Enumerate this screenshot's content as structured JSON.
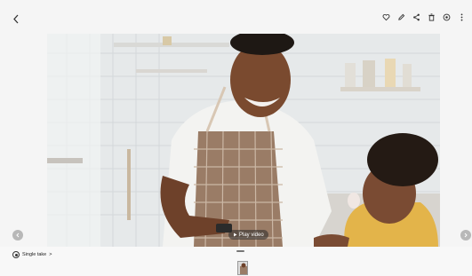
{
  "viewer": {
    "back_icon": "chevron-left-icon",
    "actions": [
      {
        "name": "favorite",
        "icon": "heart-icon"
      },
      {
        "name": "edit",
        "icon": "pencil-icon"
      },
      {
        "name": "share",
        "icon": "share-icon"
      },
      {
        "name": "delete",
        "icon": "trash-icon"
      },
      {
        "name": "bixby-vision",
        "icon": "eye-scan-icon"
      },
      {
        "name": "more",
        "icon": "more-vertical-icon"
      }
    ]
  },
  "photo": {
    "play_label": "Play video",
    "prev_icon": "chevron-left-icon",
    "next_icon": "chevron-right-icon"
  },
  "footer": {
    "single_take_label": "Single take",
    "single_take_chevron": ">",
    "accent": "#ffffff"
  }
}
